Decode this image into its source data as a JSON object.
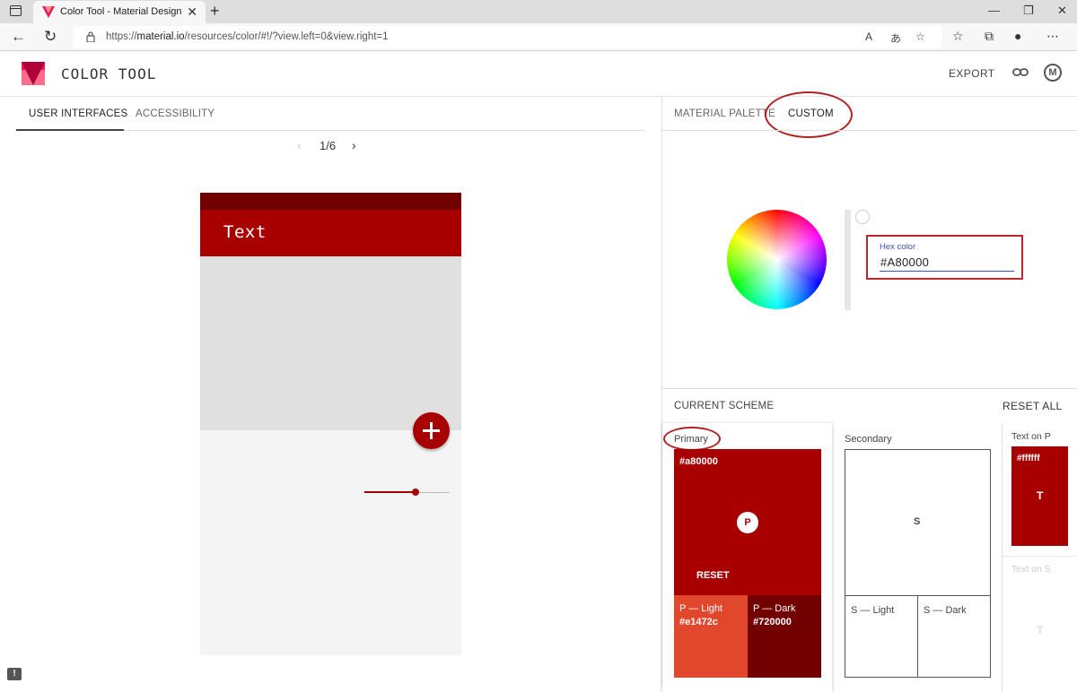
{
  "browser": {
    "tab_title": "Color Tool - Material Design",
    "tab_close": "✕",
    "new_tab": "+",
    "url_prefix": "https://",
    "url_domain": "material.io",
    "url_rest": "/resources/color/#!/?view.left=0&view.right=1",
    "window_controls": [
      "—",
      "❐",
      "✕"
    ]
  },
  "app": {
    "title": "COLOR TOOL",
    "export_label": "EXPORT"
  },
  "left": {
    "tabs": [
      "USER INTERFACES",
      "ACCESSIBILITY"
    ],
    "pager": "1/6",
    "phone": {
      "appbar_text": "Text",
      "slider_value": 0.6
    }
  },
  "right": {
    "tabs": [
      "MATERIAL PALETTE",
      "CUSTOM"
    ],
    "hex_label": "Hex color",
    "hex_value": "#A80000",
    "current_scheme_label": "CURRENT SCHEME",
    "reset_all_label": "RESET ALL",
    "primary": {
      "label": "Primary",
      "hex": "#a80000",
      "badge": "P",
      "reset_label": "RESET",
      "light_label": "P — Light",
      "light_hex": "#e1472c",
      "dark_label": "P — Dark",
      "dark_hex": "#720000"
    },
    "secondary": {
      "label": "Secondary",
      "badge": "S",
      "light_label": "S — Light",
      "dark_label": "S — Dark"
    },
    "text_on_p": {
      "label": "Text on P",
      "hex": "#ffffff",
      "badge": "T"
    },
    "text_on_s": {
      "label": "Text on S",
      "badge": "T"
    }
  },
  "colors": {
    "primary": "#a80000",
    "primary_light": "#e1472c",
    "primary_dark": "#720000",
    "annotation": "#b22222"
  }
}
